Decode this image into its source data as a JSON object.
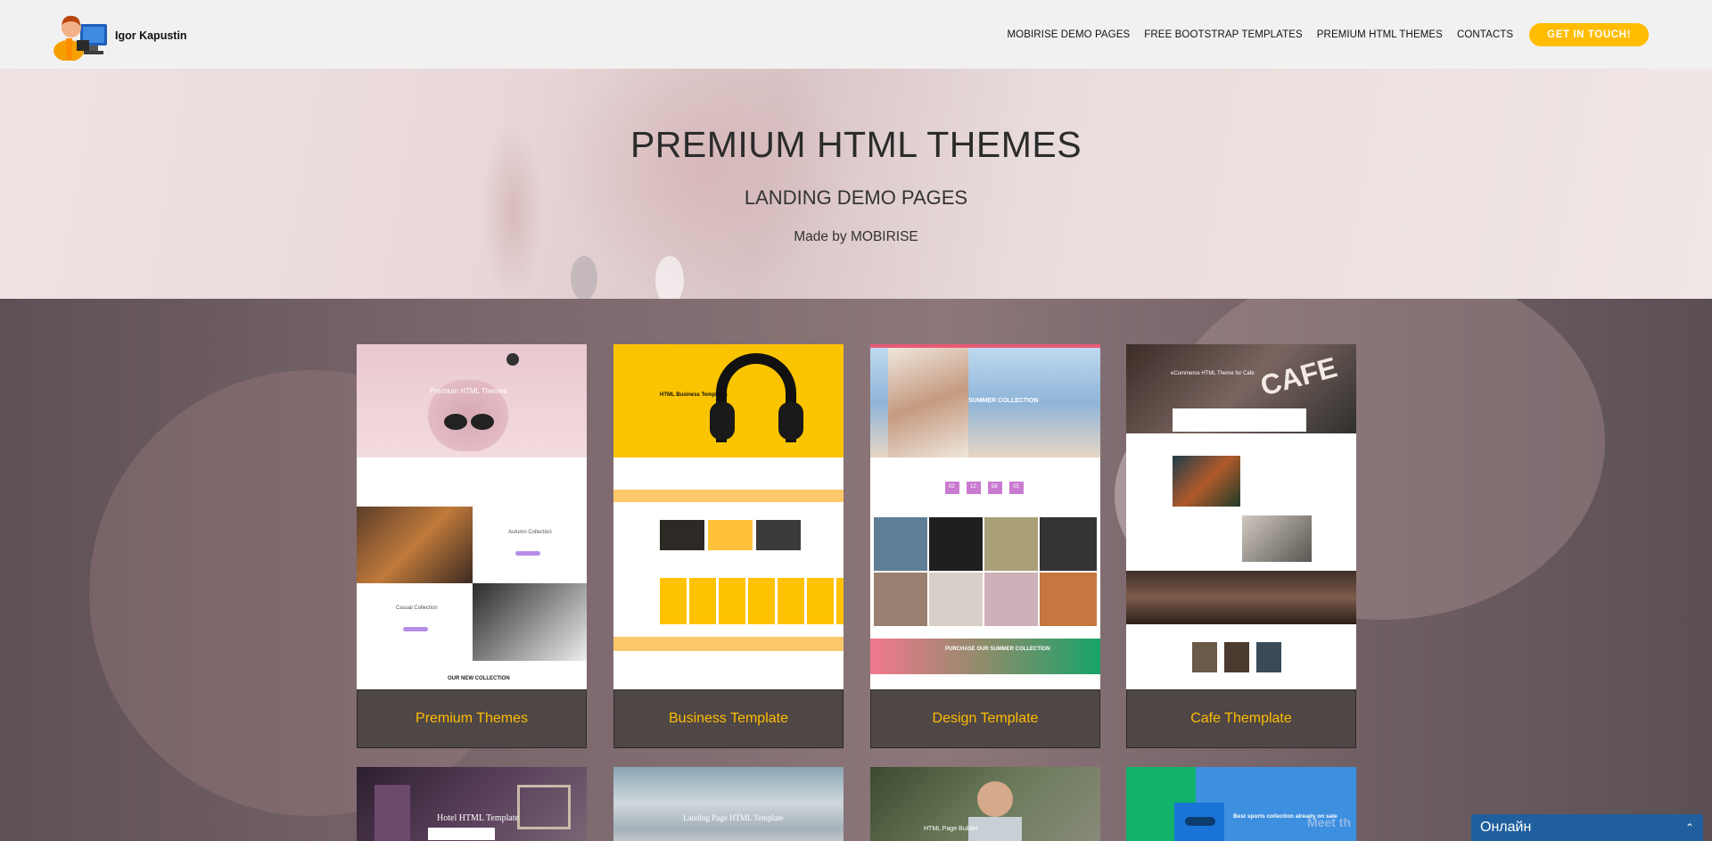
{
  "header": {
    "brand_name": "Igor Kapustin",
    "nav": [
      "MOBIRISE DEMO PAGES",
      "FREE BOOTSTRAP TEMPLATES",
      "PREMIUM HTML THEMES",
      "CONTACTS"
    ],
    "cta_label": "GET IN TOUCH!",
    "accent_color": "#ffbc00"
  },
  "hero": {
    "title": "PREMIUM HTML THEMES",
    "subtitle": "LANDING DEMO PAGES",
    "made_by": "Made by MOBIRISE"
  },
  "cards": [
    {
      "caption": "Premium Themes",
      "preview_title": "Premium HTML Themes",
      "preview_labels": [
        "Autumn Collection",
        "Casual Collection",
        "OUR NEW COLLECTION"
      ]
    },
    {
      "caption": "Business  Template",
      "preview_title": "HTML Business Templates"
    },
    {
      "caption": "Design Template",
      "preview_title": "SUMMER COLLECTION",
      "countdown": [
        "02",
        "12",
        "58",
        "05"
      ],
      "preview_labels": [
        "PURCHASE OUR SUMMER COLLECTION"
      ]
    },
    {
      "caption": "Cafe Themplate",
      "preview_title": "eCommerce HTML Theme for Cafe",
      "preview_labels": [
        "CAFE"
      ]
    }
  ],
  "second_row": [
    {
      "preview_title": "Hotel HTML Template"
    },
    {
      "preview_title": "Landing Page HTML Template"
    },
    {
      "preview_title": "HTML Page Builder"
    },
    {
      "preview_title": "Best sports collection already on sale",
      "preview_labels": [
        "Meet th"
      ]
    }
  ],
  "chat": {
    "label": "Онлайн",
    "color": "#1f5f9d"
  }
}
